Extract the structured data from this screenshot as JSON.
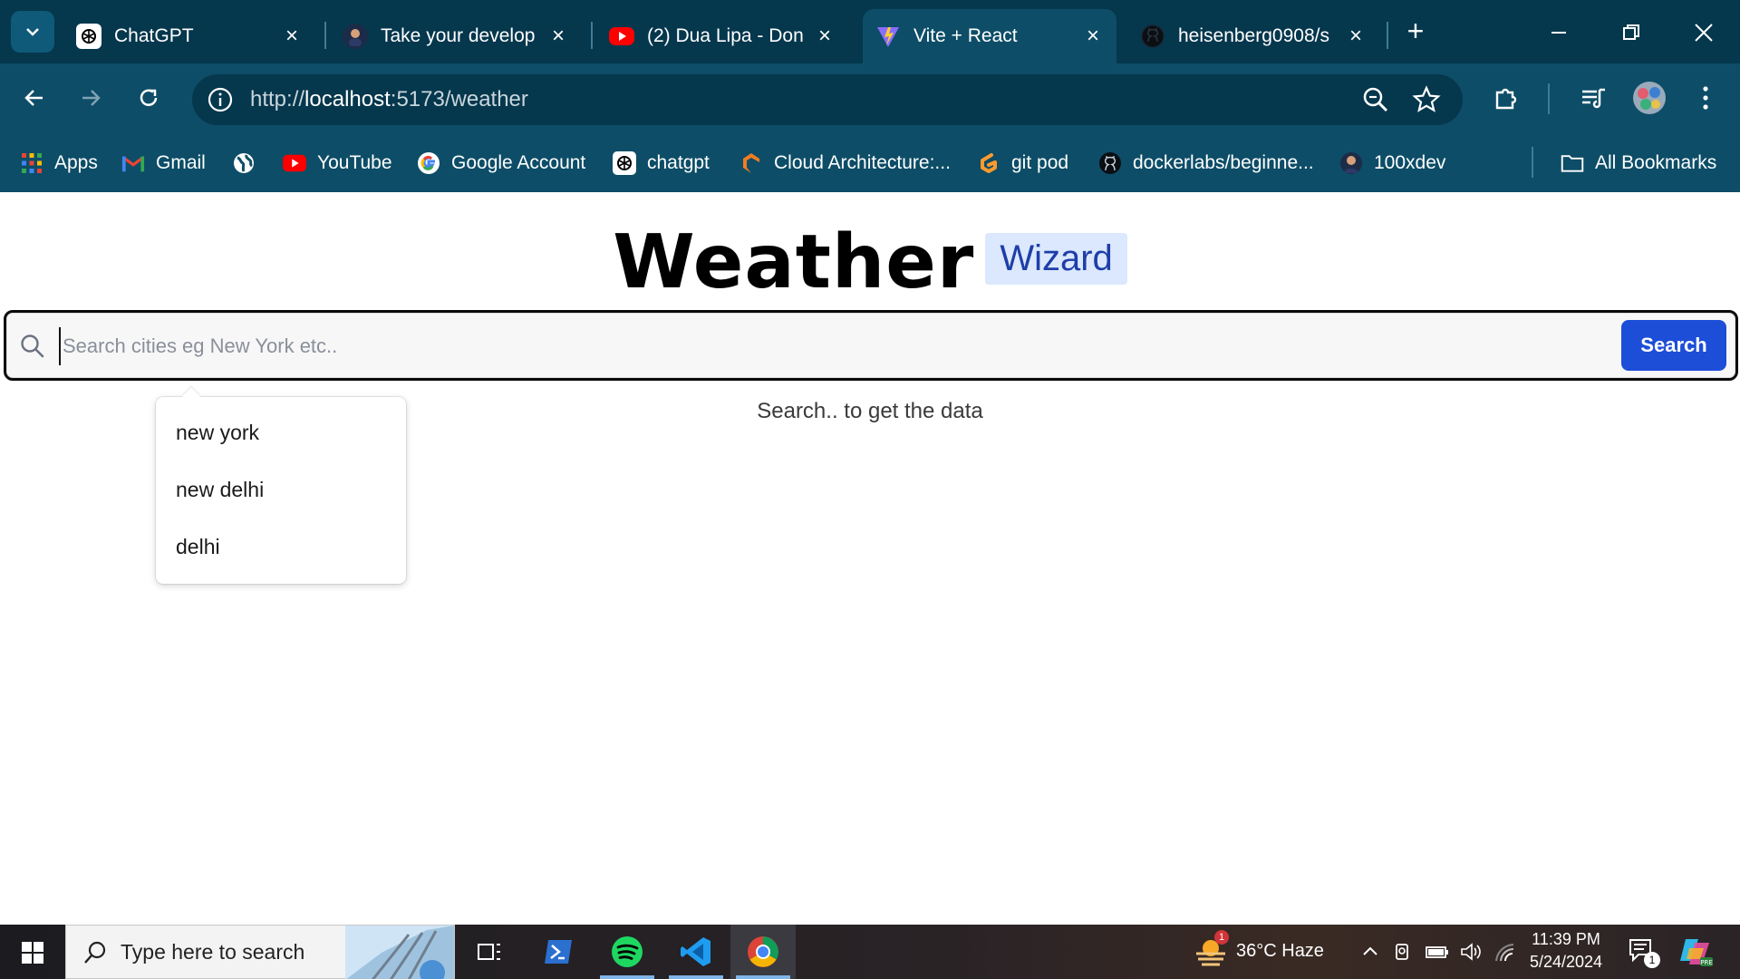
{
  "tabs": [
    {
      "title": "ChatGPT",
      "icon": "chatgpt-icon"
    },
    {
      "title": "Take your develop",
      "icon": "avatar-icon"
    },
    {
      "title": "(2) Dua Lipa - Don",
      "icon": "youtube-icon"
    },
    {
      "title": "Vite + React",
      "icon": "vite-icon",
      "active": true
    },
    {
      "title": "heisenberg0908/s",
      "icon": "github-icon"
    }
  ],
  "address_bar": {
    "scheme": "http://",
    "host": "localhost",
    "rest": ":5173/weather"
  },
  "bookmarks": [
    {
      "label": "Apps",
      "icon": "apps-grid-icon"
    },
    {
      "label": "Gmail",
      "icon": "gmail-icon"
    },
    {
      "label": "",
      "icon": "globe-icon"
    },
    {
      "label": "YouTube",
      "icon": "youtube-icon"
    },
    {
      "label": "Google Account",
      "icon": "google-icon"
    },
    {
      "label": "chatgpt",
      "icon": "chatgpt-icon"
    },
    {
      "label": "Cloud Architecture:...",
      "icon": "cloud-arch-icon"
    },
    {
      "label": "git pod",
      "icon": "gitpod-icon"
    },
    {
      "label": "dockerlabs/beginne...",
      "icon": "github-icon"
    },
    {
      "label": "100xdev",
      "icon": "avatar-icon"
    }
  ],
  "all_bookmarks_label": "All Bookmarks",
  "app": {
    "title_main": "Weather",
    "title_badge": "Wizard",
    "search": {
      "placeholder": "Search cities eg New York etc..",
      "button_label": "Search"
    },
    "suggestions": [
      "new york",
      "new delhi",
      "delhi"
    ],
    "hint": "Search.. to get the data"
  },
  "taskbar": {
    "search_placeholder": "Type here to search",
    "weather": "36°C  Haze",
    "weather_badge": "1",
    "time": "11:39 PM",
    "date": "5/24/2024",
    "notification_count": "1"
  },
  "colors": {
    "chrome_dark": "#05374d",
    "chrome_mid": "#0d4d67",
    "search_button": "#1d4ed8",
    "wizard_badge_bg": "#dbe8fd",
    "wizard_badge_text": "#1e3ea8"
  }
}
